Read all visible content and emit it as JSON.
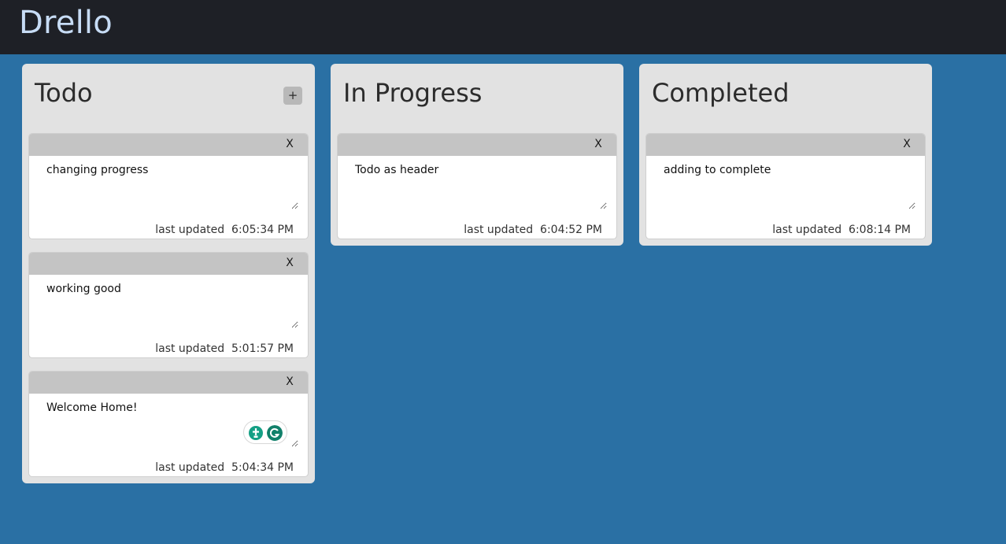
{
  "app": {
    "title": "Drello"
  },
  "columns": [
    {
      "title": "Todo",
      "add_label": "+",
      "cards": [
        {
          "text": "changing progress",
          "close_label": "X",
          "updated_label": "last updated",
          "time": "6:05:34 PM"
        },
        {
          "text": "working good",
          "close_label": "X",
          "updated_label": "last updated",
          "time": "5:01:57 PM"
        },
        {
          "text": "Welcome Home!",
          "close_label": "X",
          "updated_label": "last updated",
          "time": "5:04:34 PM"
        }
      ]
    },
    {
      "title": "In Progress",
      "cards": [
        {
          "text": "Todo as header",
          "close_label": "X",
          "updated_label": "last updated",
          "time": "6:04:52 PM"
        }
      ]
    },
    {
      "title": "Completed",
      "cards": [
        {
          "text": "adding to complete",
          "close_label": "X",
          "updated_label": "last updated",
          "time": "6:08:14 PM"
        }
      ]
    }
  ],
  "colors": {
    "background": "#2a70a4",
    "topbar": "#1e2026",
    "brand_text": "#c7dcf5",
    "column_bg": "#e2e2e2",
    "card_header": "#c4c4c4",
    "grammarly_green": "#15a085"
  },
  "icons": {
    "add": "plus-icon",
    "close": "close-icon",
    "grammarly": [
      "grammarly-suggestion-icon",
      "grammarly-logo-icon"
    ]
  }
}
